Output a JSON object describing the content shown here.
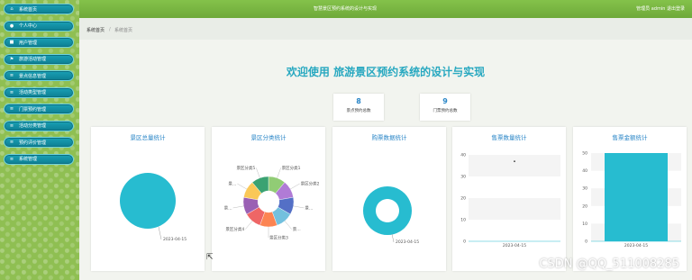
{
  "topbar": {
    "title": "智慧景区预约系统的设计与实现",
    "user": "管理员 admin   退出登录"
  },
  "sidebar": {
    "items": [
      {
        "label": "系统首页",
        "icon": "home-icon",
        "glyph": "⌂"
      },
      {
        "label": "个人中心",
        "icon": "user-icon",
        "glyph": "●"
      },
      {
        "label": "用户管理",
        "icon": "group-icon",
        "glyph": "■"
      },
      {
        "label": "旅游活动管理",
        "icon": "flag-icon",
        "glyph": "⚑"
      },
      {
        "label": "景点信息管理",
        "icon": "list-icon",
        "glyph": "≡"
      },
      {
        "label": "活动类型管理",
        "icon": "list-icon",
        "glyph": "≡"
      },
      {
        "label": "门票预约管理",
        "icon": "list-icon",
        "glyph": "≡"
      },
      {
        "label": "活动分类管理",
        "icon": "list-icon",
        "glyph": "≡"
      },
      {
        "label": "预约评价管理",
        "icon": "list-icon",
        "glyph": "≡"
      },
      {
        "label": "系统管理",
        "icon": "list-icon",
        "glyph": "≡"
      }
    ]
  },
  "breadcrumb": {
    "home": "系统首页",
    "sep": "/",
    "current": "系统首页"
  },
  "welcome": "欢迎使用 旅游景区预约系统的设计与实现",
  "stats": [
    {
      "value": "8",
      "label": "景点预约总数"
    },
    {
      "value": "9",
      "label": "门票预约总数"
    }
  ],
  "cards": [
    {
      "title": "景区总量统计"
    },
    {
      "title": "景区分类统计"
    },
    {
      "title": "购票数据统计"
    },
    {
      "title": "售票数量统计"
    },
    {
      "title": "售票金额统计"
    }
  ],
  "chart_data": [
    {
      "type": "pie",
      "title": "景区总量统计",
      "slices": [
        {
          "label": "2023-04-15",
          "value": 1
        }
      ],
      "colors": [
        "#27bcd0"
      ]
    },
    {
      "type": "pie",
      "title": "景区分类统计",
      "donut": true,
      "slices": [
        {
          "label": "景区分类1",
          "value": 1,
          "color": "#91cc75"
        },
        {
          "label": "景区分类2",
          "value": 1,
          "color": "#b07bd6"
        },
        {
          "label": "景…",
          "value": 1,
          "color": "#5470c6"
        },
        {
          "label": "景…",
          "value": 1,
          "color": "#73c0de"
        },
        {
          "label": "景区分类3",
          "value": 1,
          "color": "#fc8452"
        },
        {
          "label": "景区分类4",
          "value": 1,
          "color": "#ee6666"
        },
        {
          "label": "景…",
          "value": 1,
          "color": "#9a60b4"
        },
        {
          "label": "景…",
          "value": 1,
          "color": "#fac858"
        },
        {
          "label": "景区分类5",
          "value": 1,
          "color": "#3ba272"
        }
      ],
      "visible_labels": [
        "景区分类5",
        "景区分类1",
        "景…",
        "景…",
        "景…",
        "景…",
        "景区分类3",
        "景区分类4"
      ]
    },
    {
      "type": "pie",
      "title": "购票数据统计",
      "donut": true,
      "slices": [
        {
          "label": "2023-04-15",
          "value": 1
        }
      ],
      "colors": [
        "#27bcd0"
      ]
    },
    {
      "type": "line",
      "title": "售票数量统计",
      "categories": [
        "2023-04-15"
      ],
      "values": [
        37
      ],
      "ylim": [
        0,
        40
      ],
      "yticks": [
        "40",
        "30",
        "20",
        "10",
        "0"
      ],
      "grid": true
    },
    {
      "type": "bar",
      "title": "售票金额统计",
      "categories": [
        "2023-04-15"
      ],
      "values": [
        50
      ],
      "ylim": [
        0,
        50
      ],
      "yticks": [
        "50",
        "40",
        "30",
        "20",
        "10",
        "0"
      ],
      "color": "#27bcd0",
      "grid": true
    }
  ],
  "watermark": "CSDN @QQ_511008285",
  "cursor_glyph": "⇱"
}
